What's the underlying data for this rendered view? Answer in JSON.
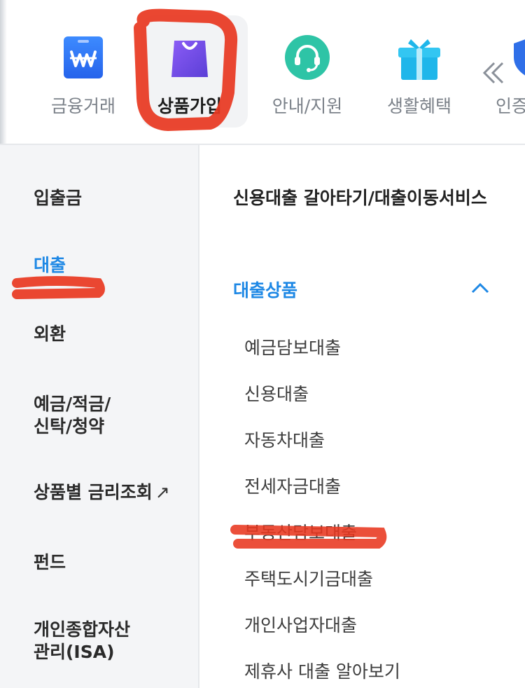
{
  "topnav": {
    "items": [
      {
        "label": "금융거래",
        "icon": "wallet-icon"
      },
      {
        "label": "상품가입",
        "icon": "shopping-bag-icon"
      },
      {
        "label": "안내/지원",
        "icon": "headset-icon"
      },
      {
        "label": "생활혜택",
        "icon": "gift-icon"
      },
      {
        "label": "인증",
        "icon": "shield-icon"
      }
    ],
    "active_index": 1,
    "colors": {
      "active_label": "#1c1c1c",
      "inactive_label": "#7b8189"
    }
  },
  "sidebar": {
    "items": [
      {
        "label": "입출금"
      },
      {
        "label": "대출"
      },
      {
        "label": "외환"
      },
      {
        "label": "예금/적금/",
        "label2": "신탁/청약"
      },
      {
        "label": "상품별 금리조회",
        "ext": "↗"
      },
      {
        "label": "펀드"
      },
      {
        "label": "개인종합자산",
        "label2": "관리(ISA)"
      }
    ],
    "active_index": 1
  },
  "content": {
    "service_title": "신용대출 갈아타기/대출이동서비스",
    "section_title": "대출상품",
    "section_expanded": true,
    "items": [
      "예금담보대출",
      "신용대출",
      "자동차대출",
      "전세자금대출",
      "부동산담보대출",
      "주택도시기금대출",
      "개인사업자대출",
      "제휴사 대출 알아보기"
    ]
  },
  "colors": {
    "accent": "#1e88e5",
    "sidebar_bg": "#f4f5f7",
    "annotation_red": "#e8371f"
  }
}
